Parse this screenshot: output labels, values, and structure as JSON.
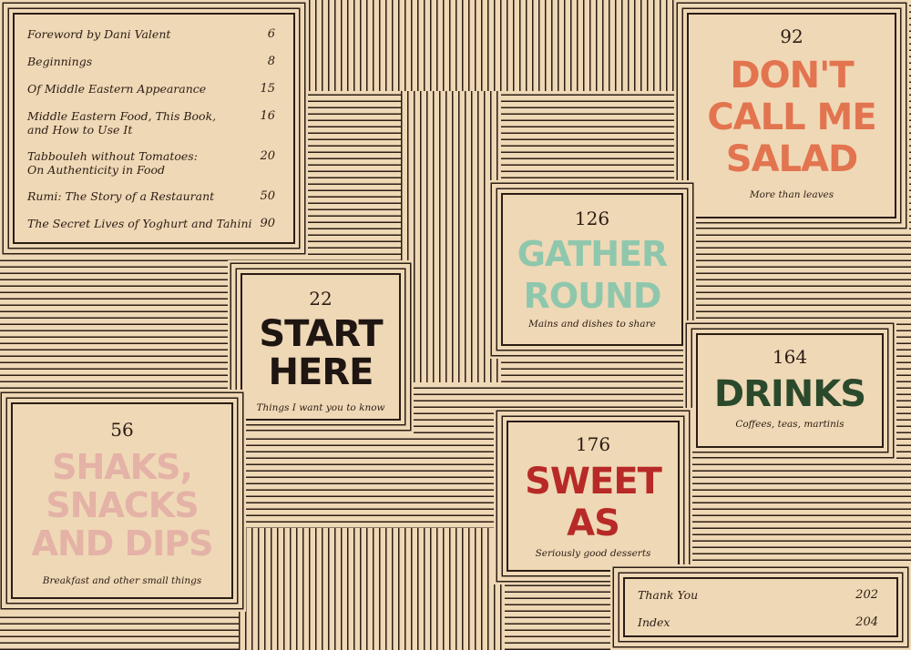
{
  "contents": [
    {
      "title": "Foreword by Dani Valent",
      "page": "6"
    },
    {
      "title": "Beginnings",
      "page": "8"
    },
    {
      "title": "Of Middle Eastern Appearance",
      "page": "15"
    },
    {
      "title": "Middle Eastern Food, This Book,\nand How to Use It",
      "page": "16"
    },
    {
      "title": "Tabbouleh without Tomatoes:\nOn Authenticity in Food",
      "page": "20"
    },
    {
      "title": "Rumi: The Story of a Restaurant",
      "page": "50"
    },
    {
      "title": "The Secret Lives of Yoghurt and Tahini",
      "page": "90"
    }
  ],
  "chapters": {
    "start_here": {
      "page": "22",
      "title": "Start\nHere",
      "subtitle": "Things I want you to know",
      "color": "#1f1612"
    },
    "shaks": {
      "page": "56",
      "title": "Shaks,\nSnacks\nand Dips",
      "subtitle": "Breakfast and other small things",
      "color": "#e4b2a6"
    },
    "salad": {
      "page": "92",
      "title": "Don't\nCall Me\nSalad",
      "subtitle": "More than leaves",
      "color": "#e2744f"
    },
    "gather": {
      "page": "126",
      "title": "Gather\nRound",
      "subtitle": "Mains and dishes to share",
      "color": "#8fc7ad"
    },
    "drinks": {
      "page": "164",
      "title": "Drinks",
      "subtitle": "Coffees, teas, martinis",
      "color": "#2b4a2c"
    },
    "sweet": {
      "page": "176",
      "title": "Sweet\nAs",
      "subtitle": "Seriously good desserts",
      "color": "#b72a27"
    }
  },
  "end_matter": [
    {
      "title": "Thank You",
      "page": "202"
    },
    {
      "title": "Index",
      "page": "204"
    }
  ]
}
